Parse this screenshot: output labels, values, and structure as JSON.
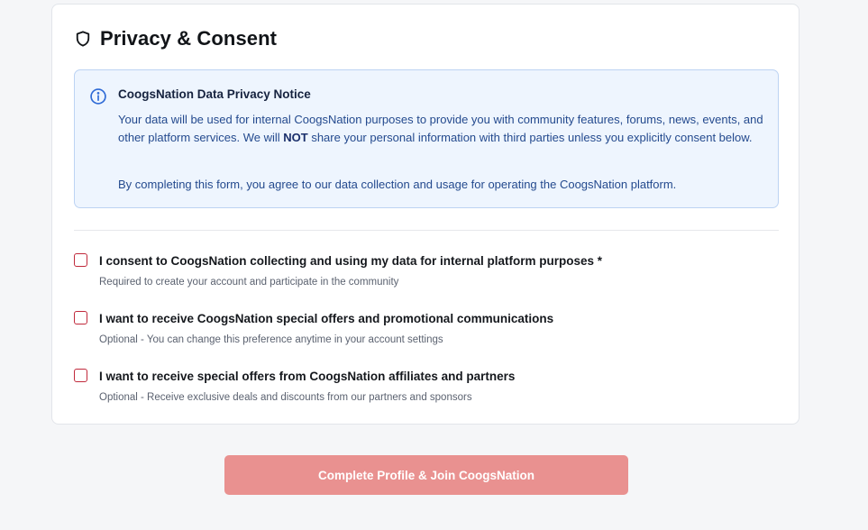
{
  "section": {
    "title": "Privacy & Consent",
    "icon": "shield-icon"
  },
  "notice": {
    "icon": "info-icon",
    "title": "CoogsNation Data Privacy Notice",
    "para1_before": "Your data will be used for internal CoogsNation purposes to provide you with community features, forums, news, events, and other platform services. We will ",
    "para1_emphasis": "NOT",
    "para1_after": " share your personal information with third parties unless you explicitly consent below.",
    "para2": "By completing this form, you agree to our data collection and usage for operating the CoogsNation platform."
  },
  "consents": [
    {
      "label": "I consent to CoogsNation collecting and using my data for internal platform purposes *",
      "description": "Required to create your account and participate in the community",
      "checked": false
    },
    {
      "label": "I want to receive CoogsNation special offers and promotional communications",
      "description": "Optional - You can change this preference anytime in your account settings",
      "checked": false
    },
    {
      "label": "I want to receive special offers from CoogsNation affiliates and partners",
      "description": "Optional - Receive exclusive deals and discounts from our partners and sponsors",
      "checked": false
    }
  ],
  "submit": {
    "label": "Complete Profile & Join CoogsNation"
  },
  "colors": {
    "accent": "#c0293b",
    "button_disabled": "#e99190",
    "notice_bg": "#eef5fe",
    "notice_border": "#bcd3f3",
    "notice_text": "#244a8e"
  }
}
